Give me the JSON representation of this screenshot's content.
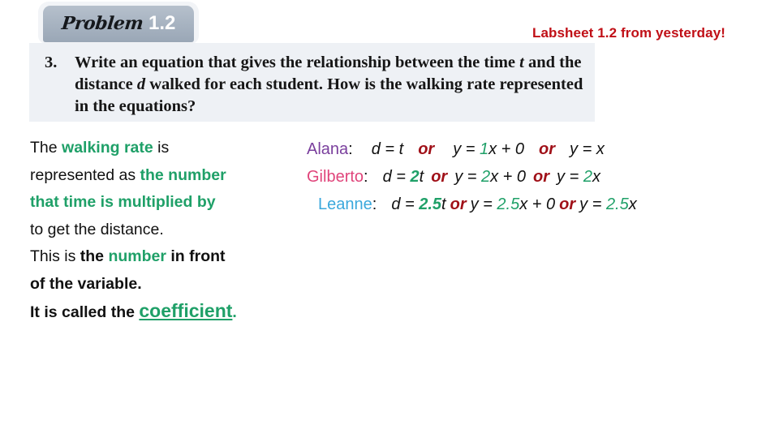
{
  "badge": {
    "word": "Problem",
    "number": "1.2"
  },
  "labsheet_note": "Labsheet 1.2 from yesterday!",
  "question": {
    "number": "3.",
    "part1": "Write an equation that gives the relationship between the time ",
    "var_t": "t",
    "part2": " and the distance ",
    "var_d": "d",
    "part3": " walked for each student. How is the walking rate represented in the equations?"
  },
  "explanation": {
    "l1_a": "The ",
    "l1_b": "walking rate",
    "l1_c": " is",
    "l2_a": "represented as ",
    "l2_b": "the number",
    "l3": "that time is multiplied by",
    "l4": "to get the distance.",
    "l5_a": "This is ",
    "l5_b": "the ",
    "l5_c": "number",
    "l5_d": " in front",
    "l6": "of the variable.",
    "l7_a": "It is called the ",
    "l7_b": "coefficient",
    "l7_c": "."
  },
  "equations": {
    "or_label": "or",
    "rows": [
      {
        "name": "Alana",
        "colon": ":",
        "name_color": "#7a3f9d",
        "eq1_lhs": "d = ",
        "eq1_coef": "",
        "eq1_rhs": "t",
        "eq2_lhs": "y = ",
        "eq2_coef": "1",
        "eq2_rhs": "x + 0",
        "eq3_lhs": "y = ",
        "eq3_coef": "",
        "eq3_rhs": "x"
      },
      {
        "name": "Gilberto",
        "colon": ":",
        "name_color": "#e0457b",
        "eq1_lhs": "d = ",
        "eq1_coef": "2",
        "eq1_rhs": "t",
        "eq2_lhs": "y  = ",
        "eq2_coef": "2",
        "eq2_rhs": "x + 0",
        "eq3_lhs": "y = ",
        "eq3_coef": "2",
        "eq3_rhs": "x"
      },
      {
        "name": "Leanne",
        "colon": ":",
        "name_color": "#3aa8dc",
        "eq1_lhs": "d = ",
        "eq1_coef": "2.5",
        "eq1_rhs": "t",
        "eq2_lhs": "y = ",
        "eq2_coef": "2.5",
        "eq2_rhs": "x + 0",
        "eq3_lhs": "y = ",
        "eq3_coef": "2.5",
        "eq3_rhs": "x"
      }
    ]
  },
  "colors": {
    "green": "#1fa068",
    "dark_red": "#a01018",
    "labsheet_red": "#c00f16",
    "badge_gray": "#a6b2c0",
    "box_bg": "#eef1f5"
  }
}
